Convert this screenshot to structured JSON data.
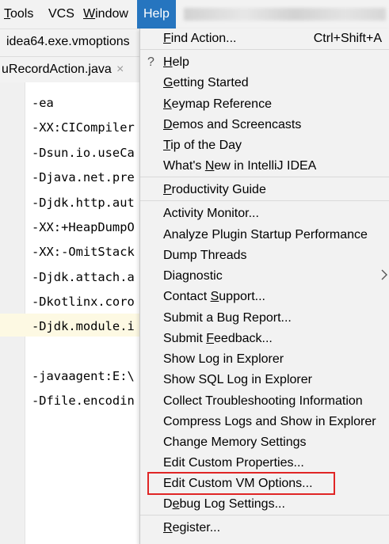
{
  "menubar": {
    "items": [
      {
        "label": "Tools",
        "mnemonic": "T",
        "rest": "ools"
      },
      {
        "label": "VCS",
        "mnemonic": "",
        "rest": "VCS"
      },
      {
        "label": "Window",
        "mnemonic": "W",
        "rest": "indow"
      },
      {
        "label": "Help",
        "mnemonic": "",
        "rest": "Help"
      }
    ]
  },
  "tabs": {
    "open_file": "idea64.exe.vmoptions",
    "editor_tab": "uRecordAction.java",
    "close_glyph": "×"
  },
  "editor": {
    "lines": [
      "-ea",
      "-XX:CICompiler",
      "-Dsun.io.useCa",
      "-Djava.net.pre",
      "-Djdk.http.aut",
      "-XX:+HeapDumpO",
      "-XX:-OmitStack",
      "-Djdk.attach.a",
      "-Dkotlinx.coro",
      "-Djdk.module.i",
      "",
      "-javaagent:E:\\",
      "-Dfile.encodin"
    ]
  },
  "help_menu": {
    "find_action": {
      "mnemonic": "F",
      "rest": "ind Action...",
      "shortcut": "Ctrl+Shift+A"
    },
    "help": {
      "icon": "?",
      "mnemonic": "H",
      "rest": "elp"
    },
    "getting_started": {
      "mnemonic": "G",
      "rest": "etting Started"
    },
    "keymap_reference": {
      "mnemonic": "K",
      "rest": "eymap Reference"
    },
    "demos": {
      "mnemonic": "D",
      "rest": "emos and Screencasts"
    },
    "tip": {
      "mnemonic": "T",
      "rest": "ip of the Day"
    },
    "whats_new": {
      "pre": "What's ",
      "mnemonic": "N",
      "rest": "ew in IntelliJ IDEA"
    },
    "productivity": {
      "mnemonic": "P",
      "rest": "roductivity Guide"
    },
    "activity_monitor": {
      "label": "Activity Monitor..."
    },
    "analyze_plugin": {
      "label": "Analyze Plugin Startup Performance"
    },
    "dump_threads": {
      "label": "Dump Threads"
    },
    "diagnostic": {
      "label": "Diagnostic"
    },
    "contact_support": {
      "pre": "Contact ",
      "mnemonic": "S",
      "rest": "upport..."
    },
    "submit_bug": {
      "label": "Submit a Bug Report..."
    },
    "submit_feedback": {
      "pre": "Submit ",
      "mnemonic": "F",
      "rest": "eedback..."
    },
    "show_log": {
      "label": "Show Log in Explorer"
    },
    "show_sql_log": {
      "label": "Show SQL Log in Explorer"
    },
    "collect_troubleshooting": {
      "label": "Collect Troubleshooting Information"
    },
    "compress_logs": {
      "label": "Compress Logs and Show in Explorer"
    },
    "change_memory": {
      "label": "Change Memory Settings"
    },
    "edit_custom_props": {
      "label": "Edit Custom Properties..."
    },
    "edit_custom_vm": {
      "label": "Edit Custom VM Options..."
    },
    "debug_log": {
      "pre": "D",
      "mnemonic": "e",
      "rest": "bug Log Settings..."
    },
    "register": {
      "mnemonic": "R",
      "rest": "egister..."
    }
  },
  "colors": {
    "menu_active": "#2675bf",
    "highlight_box": "#e02525"
  }
}
